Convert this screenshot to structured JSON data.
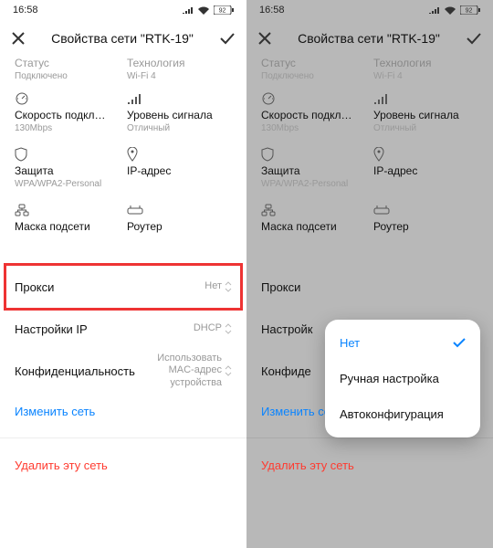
{
  "status": {
    "time": "16:58",
    "battery": "92"
  },
  "header": {
    "title": "Свойства сети \"RTK-19\""
  },
  "info": {
    "status_label": "Статус",
    "status_value": "Подключено",
    "tech_label": "Технология",
    "tech_value": "Wi-Fi 4",
    "speed_label": "Скорость подкл…",
    "speed_value": "130Mbps",
    "signal_label": "Уровень сигнала",
    "signal_value": "Отличный",
    "security_label": "Защита",
    "security_value": "WPA/WPA2-Personal",
    "ip_label": "IP-адрес",
    "mask_label": "Маска подсети",
    "router_label": "Роутер"
  },
  "rows": {
    "proxy_label": "Прокси",
    "proxy_value": "Нет",
    "ip_settings_label": "Настройки IP",
    "ip_settings_label_short": "Настройк",
    "ip_settings_value": "DHCP",
    "privacy_label": "Конфиденциальность",
    "privacy_label_short": "Конфиде",
    "privacy_value": "Использовать MAC-адрес устройства",
    "edit_network": "Изменить сеть",
    "delete_network": "Удалить эту сеть"
  },
  "popup": {
    "opt_none": "Нет",
    "opt_manual": "Ручная настройка",
    "opt_auto": "Автоконфигурация"
  }
}
